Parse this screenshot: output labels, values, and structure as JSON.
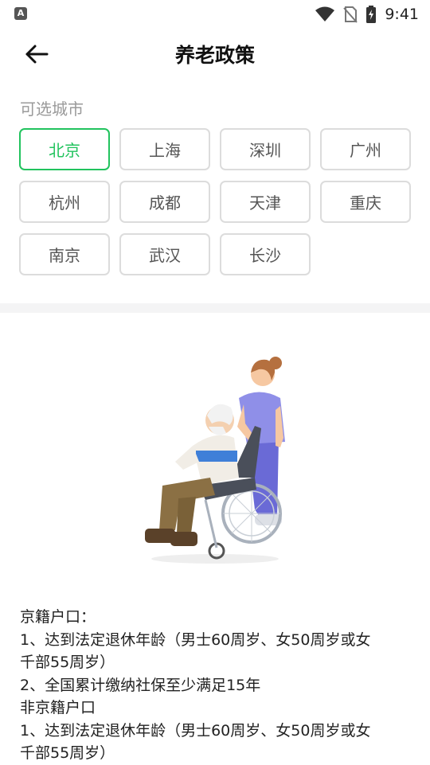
{
  "status_bar": {
    "left_icon_letter": "A",
    "time": "9:41",
    "icons": [
      "wifi-icon",
      "no-sim-icon",
      "battery-charging-icon"
    ]
  },
  "header": {
    "back_icon": "arrow-left-icon",
    "title": "养老政策"
  },
  "city_section": {
    "label": "可选城市",
    "selected": "北京",
    "cities": [
      "北京",
      "上海",
      "深圳",
      "广州",
      "杭州",
      "成都",
      "天津",
      "重庆",
      "南京",
      "武汉",
      "长沙"
    ]
  },
  "colors": {
    "accent": "#22c35e",
    "label_gray": "#9a9a9a",
    "border_gray": "#dcdcdc",
    "divider": "#f4f4f5"
  },
  "illustration": {
    "subject": "caregiver-pushing-elderly-man-in-wheelchair"
  },
  "policy": {
    "lines": [
      "京籍户口：",
      "1、达到法定退休年龄（男士60周岁、女50周岁或女",
      "千部55周岁）",
      "2、全国累计缴纳社保至少满足15年",
      "非京籍户口",
      "1、达到法定退休年龄（男士60周岁、女50周岁或女",
      "千部55周岁）"
    ]
  }
}
